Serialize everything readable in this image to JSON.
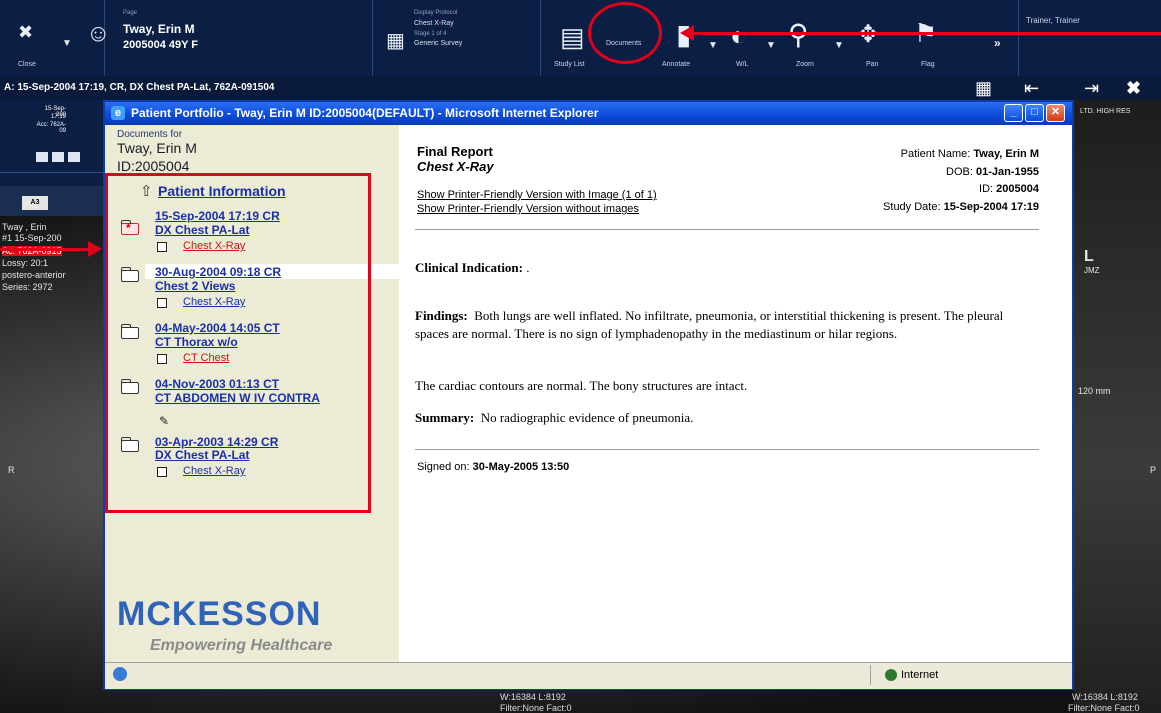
{
  "toolbar": {
    "close_label": "Close",
    "patient_small": "Page",
    "patient_name": "Tway, Erin M",
    "patient_id_age": "2005004 49Y F",
    "display_protocol_label": "Display Protocol",
    "display_protocol_name": "Chest X-Ray",
    "display_stage": "Stage 1 of 4",
    "display_survey": "Generic Survey",
    "tools": [
      "Study List",
      "Documents",
      "Annotate",
      "W/L",
      "Zoom",
      "Pan",
      "Flag"
    ],
    "user_label": "Trainer, Trainer"
  },
  "series_bar": {
    "text": "A: 15-Sep-2004 17:19, CR, DX Chest PA-Lat, 762A-091504"
  },
  "thumb": {
    "date": "15-Sep-200",
    "time": "17:19",
    "acc": "Acc: 762A-09",
    "a3": "A3"
  },
  "image_overlay": {
    "name": "Tway , Erin",
    "series_num": "#1 15-Sep-200",
    "acc_hi": "Ac: 762A-0915",
    "lossy": "Lossy: 20:1",
    "view": "postero-anterior",
    "series": "Series: 2972",
    "r_label": "R",
    "p_label": "P",
    "scale": "120 mm",
    "jmz": "JMZ",
    "l_marker": "L",
    "wl_center": "W:16384 L:8192",
    "filter_center": "Filter:None Fact:0",
    "wl_right": "W:16384 L:8192",
    "filter_right": "Filter:None Fact:0",
    "lossy_bottom": "Lossy: 20:1",
    "right_thumb_label": "LTD. HIGH RES"
  },
  "ie_window": {
    "title": "Patient Portfolio - Tway, Erin M ID:2005004(DEFAULT) - Microsoft Internet Explorer",
    "status_zone": "Internet"
  },
  "portfolio": {
    "docs_for": "Documents for",
    "patient_name": "Tway, Erin M",
    "patient_id": "ID:2005004",
    "patient_info_link": "Patient Information",
    "studies": [
      {
        "line1": "15-Sep-2004 17:19 CR",
        "line2": "DX Chest PA-Lat",
        "doc": "Chest X-Ray",
        "doc_red": true
      },
      {
        "line1": "30-Aug-2004 09:18 CR",
        "line2": "Chest 2 Views",
        "doc": "Chest X-Ray",
        "doc_red": false
      },
      {
        "line1": "04-May-2004 14:05 CT",
        "line2": "CT Thorax w/o",
        "doc": "CT Chest",
        "doc_red": true
      },
      {
        "line1": "04-Nov-2003 01:13 CT",
        "line2": "CT ABDOMEN W IV CONTRA",
        "doc": "",
        "doc_red": false
      },
      {
        "line1": "03-Apr-2003 14:29 CR",
        "line2": "DX Chest PA-Lat",
        "doc": "Chest X-Ray",
        "doc_red": false
      }
    ],
    "logo_main": "MCKESSON",
    "logo_tag": "Empowering Healthcare"
  },
  "report": {
    "title": "Final Report",
    "subtitle": "Chest X-Ray",
    "print_with_image": "Show Printer-Friendly Version with Image (1 of 1)",
    "print_without_images": "Show Printer-Friendly Version without images",
    "patient_name_label": "Patient Name:",
    "patient_name": "Tway, Erin M",
    "dob_label": "DOB:",
    "dob": "01-Jan-1955",
    "id_label": "ID:",
    "id": "2005004",
    "study_date_label": "Study Date:",
    "study_date": "15-Sep-2004 17:19",
    "clinical_label": "Clinical Indication:",
    "clinical_text": ".",
    "findings_label": "Findings:",
    "findings_text": "Both lungs are well inflated. No infiltrate, pneumonia, or interstitial thickening is present. The pleural spaces are normal. There is no sign of lymphadenopathy in the mediastinum or hilar regions.",
    "cardiac_text": "The cardiac contours are normal.  The bony structures are intact.",
    "summary_label": "Summary:",
    "summary_text": "No radiographic evidence of pneumonia.",
    "signed_label": "Signed on:",
    "signed_date": "30-May-2005 13:50"
  },
  "colors": {
    "toolbar_bg": "#0b1f44",
    "annotation_red": "#e0001a",
    "link_blue": "#1a30a8",
    "portfolio_bg": "#ecebd6",
    "logo_blue": "#2f63b9"
  }
}
